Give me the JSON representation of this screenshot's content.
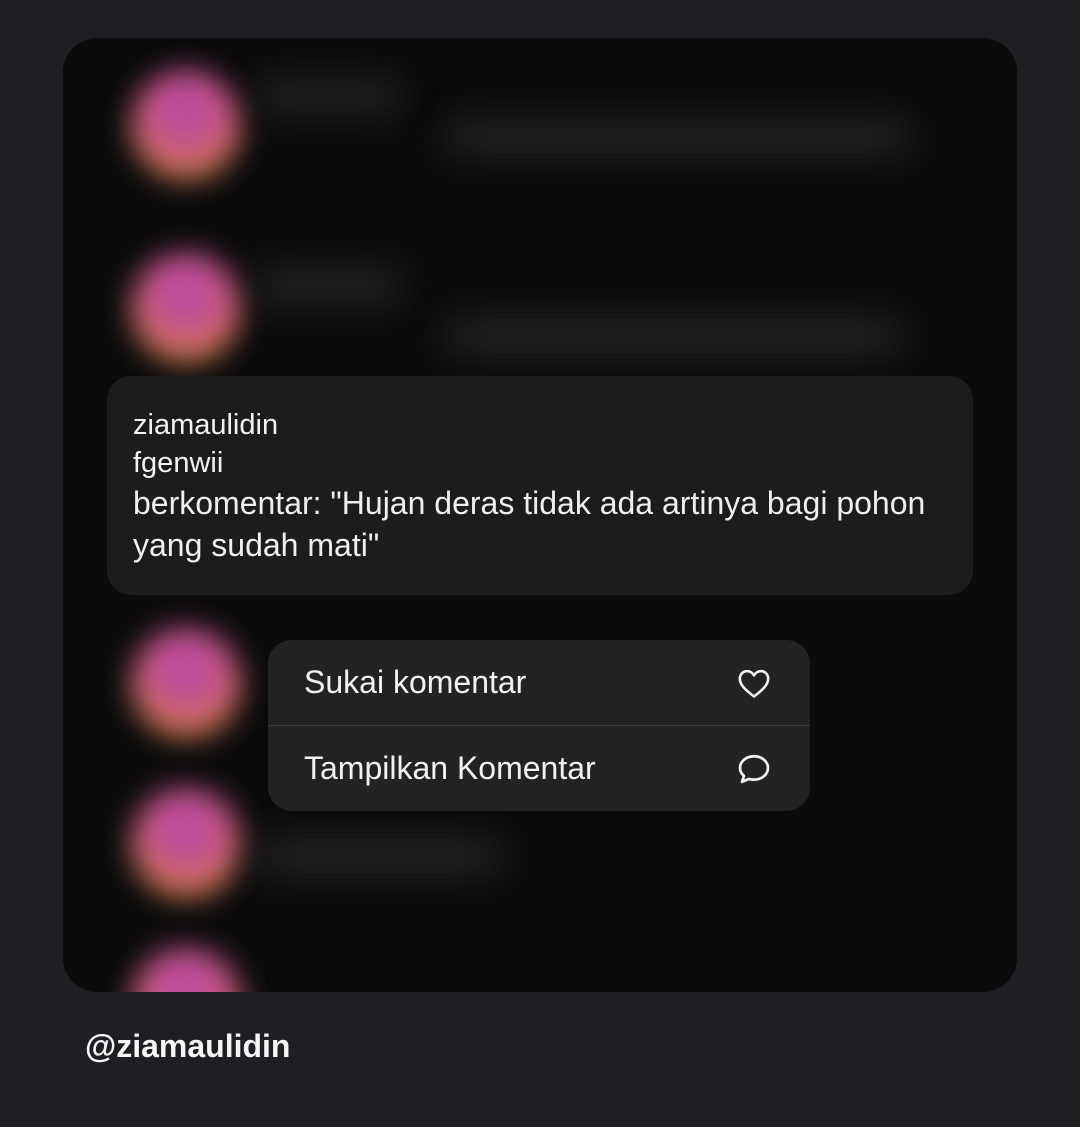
{
  "comment": {
    "username": "ziamaulidin",
    "reply_to": "fgenwii",
    "text": "berkomentar: \"Hujan deras tidak ada artinya bagi pohon yang sudah mati\""
  },
  "menu": {
    "items": [
      {
        "label": "Sukai komentar",
        "icon": "heart-icon"
      },
      {
        "label": "Tampilkan Komentar",
        "icon": "speech-bubble-icon"
      }
    ]
  },
  "footer": {
    "handle": "@ziamaulidin"
  },
  "colors": {
    "background": "#1f1f23",
    "card": "#1c1c1e",
    "menu": "#232325",
    "text": "#f2f2f2",
    "avatar_gradient": [
      "#c04ab8",
      "#e08a4a"
    ]
  }
}
